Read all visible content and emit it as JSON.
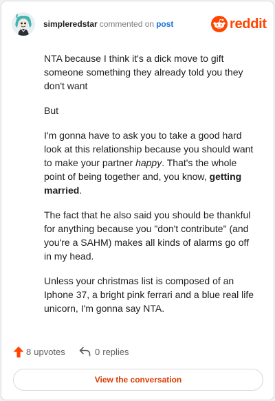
{
  "header": {
    "username": "simpleredstar",
    "action": "commented on",
    "target": "post",
    "brand": "reddit"
  },
  "comment": {
    "paragraphs": [
      "NTA because I think it's a dick move to gift someone something they already told you they don't want",
      "But",
      "I'm gonna have to ask you to take a good hard look at this relationship because you should want to make your partner ",
      "The fact that he also said you should be thankful for anything because you \"don't contribute\" (and you're a SAHM) makes all kinds of alarms go off in my head.",
      "Unless your christmas list is composed of an Iphone 37, a bright pink ferrari and a blue real life unicorn, I'm gonna say NTA."
    ],
    "p3_italic": "happy",
    "p3_mid": ". That's the whole point of being together and, you know, ",
    "p3_bold": "getting married",
    "p3_end": "."
  },
  "stats": {
    "upvote_count": "8",
    "upvote_label": "upvotes",
    "reply_count": "0",
    "reply_label": "replies"
  },
  "cta": {
    "label": "View the conversation"
  },
  "colors": {
    "brand": "#ff4500",
    "link": "#1a6ce0",
    "cta_text": "#d93a00"
  },
  "icons": [
    "avatar",
    "reddit-logo-icon",
    "upvote-arrow-icon",
    "reply-arrow-icon"
  ]
}
